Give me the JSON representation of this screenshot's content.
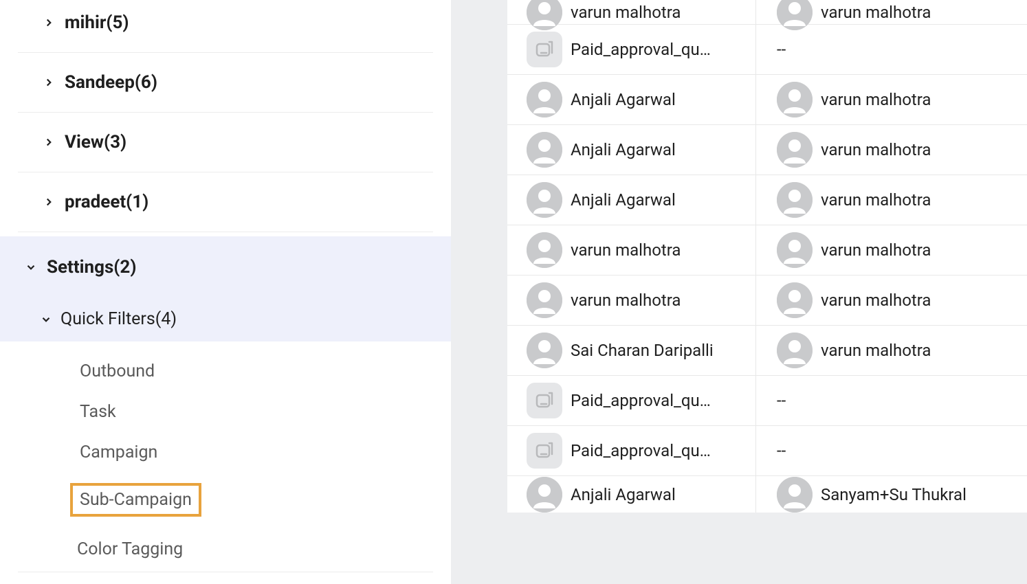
{
  "sidebar": {
    "groups": [
      {
        "label": "mihir(5)"
      },
      {
        "label": "Sandeep(6)"
      },
      {
        "label": "View(3)"
      },
      {
        "label": "pradeet(1)"
      }
    ],
    "settings_label": "Settings(2)",
    "quick_filters_label": "Quick Filters(4)",
    "quick_filters_items": [
      {
        "label": "Outbound"
      },
      {
        "label": "Task"
      },
      {
        "label": "Campaign"
      },
      {
        "label": "Sub-Campaign",
        "highlighted": true
      }
    ],
    "color_tagging_label": "Color Tagging"
  },
  "rows": [
    {
      "left": {
        "type": "avatar",
        "text": "varun malhotra"
      },
      "right": {
        "type": "avatar",
        "text": "varun malhotra"
      },
      "partial": "top"
    },
    {
      "left": {
        "type": "queue",
        "text": "Paid_approval_qu…"
      },
      "right": {
        "type": "dash",
        "text": "--"
      }
    },
    {
      "left": {
        "type": "avatar",
        "text": "Anjali Agarwal"
      },
      "right": {
        "type": "avatar",
        "text": "varun malhotra"
      }
    },
    {
      "left": {
        "type": "avatar",
        "text": "Anjali Agarwal"
      },
      "right": {
        "type": "avatar",
        "text": "varun malhotra"
      }
    },
    {
      "left": {
        "type": "avatar",
        "text": "Anjali Agarwal"
      },
      "right": {
        "type": "avatar",
        "text": "varun malhotra"
      }
    },
    {
      "left": {
        "type": "avatar",
        "text": "varun malhotra"
      },
      "right": {
        "type": "avatar",
        "text": "varun malhotra"
      }
    },
    {
      "left": {
        "type": "avatar",
        "text": "varun malhotra"
      },
      "right": {
        "type": "avatar",
        "text": "varun malhotra"
      }
    },
    {
      "left": {
        "type": "avatar",
        "text": "Sai Charan Daripalli"
      },
      "right": {
        "type": "avatar",
        "text": "varun malhotra"
      }
    },
    {
      "left": {
        "type": "queue",
        "text": "Paid_approval_qu…"
      },
      "right": {
        "type": "dash",
        "text": "--"
      }
    },
    {
      "left": {
        "type": "queue",
        "text": "Paid_approval_qu…"
      },
      "right": {
        "type": "dash",
        "text": "--"
      }
    },
    {
      "left": {
        "type": "avatar",
        "text": "Anjali Agarwal"
      },
      "right": {
        "type": "avatar",
        "text": "Sanyam+Su Thukral"
      },
      "partial": "bottom"
    }
  ]
}
